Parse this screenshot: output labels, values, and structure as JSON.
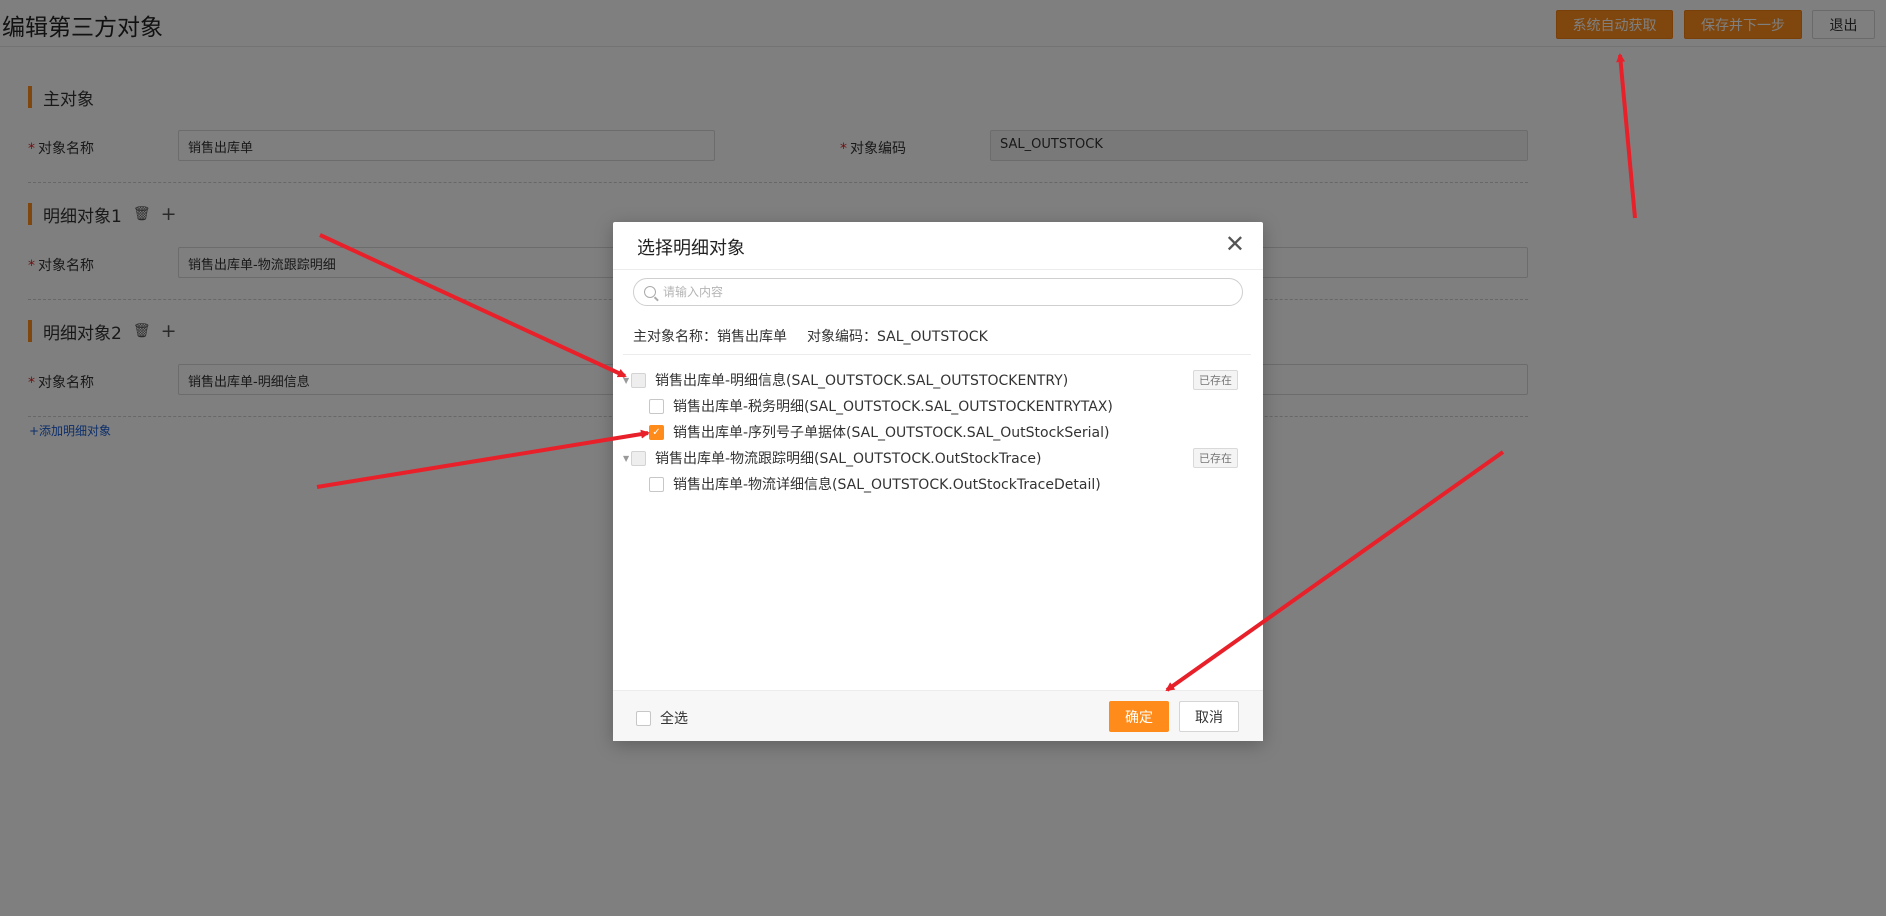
{
  "page": {
    "title": "编辑第三方对象",
    "buttons": {
      "auto_fetch": "系统自动获取",
      "save_next": "保存并下一步",
      "exit": "退出"
    }
  },
  "main_object": {
    "section_title": "主对象",
    "name_label": "对象名称",
    "name_value": "销售出库单",
    "code_label": "对象编码",
    "code_value": "SAL_OUTSTOCK"
  },
  "details": [
    {
      "section_title": "明细对象1",
      "name_label": "对象名称",
      "name_value": "销售出库单-物流跟踪明细"
    },
    {
      "section_title": "明细对象2",
      "name_label": "对象名称",
      "name_value": "销售出库单-明细信息"
    }
  ],
  "add_detail_link": "+添加明细对象",
  "modal": {
    "title": "选择明细对象",
    "search_placeholder": "请输入内容",
    "main_name": "主对象名称：销售出库单",
    "main_code": "对象编码：SAL_OUTSTOCK",
    "tree": [
      {
        "label": "销售出库单-明细信息(SAL_OUTSTOCK.SAL_OUTSTOCKENTRY)",
        "level": 0,
        "state": "disabled",
        "tag": "已存在"
      },
      {
        "label": "销售出库单-税务明细(SAL_OUTSTOCK.SAL_OUTSTOCKENTRYTAX)",
        "level": 1,
        "state": "unchecked"
      },
      {
        "label": "销售出库单-序列号子单据体(SAL_OUTSTOCK.SAL_OutStockSerial)",
        "level": 1,
        "state": "checked"
      },
      {
        "label": "销售出库单-物流跟踪明细(SAL_OUTSTOCK.OutStockTrace)",
        "level": 0,
        "state": "disabled",
        "tag": "已存在"
      },
      {
        "label": "销售出库单-物流详细信息(SAL_OUTSTOCK.OutStockTraceDetail)",
        "level": 1,
        "state": "unchecked"
      }
    ],
    "select_all": "全选",
    "ok": "确定",
    "cancel": "取消"
  },
  "colors": {
    "accent": "#ff8c1a",
    "arrow": "#e8202a",
    "link": "#1a5fd6"
  },
  "icons": [
    "trash-icon",
    "plus-icon",
    "close-icon",
    "search-icon",
    "check-icon",
    "caret-down-icon"
  ]
}
